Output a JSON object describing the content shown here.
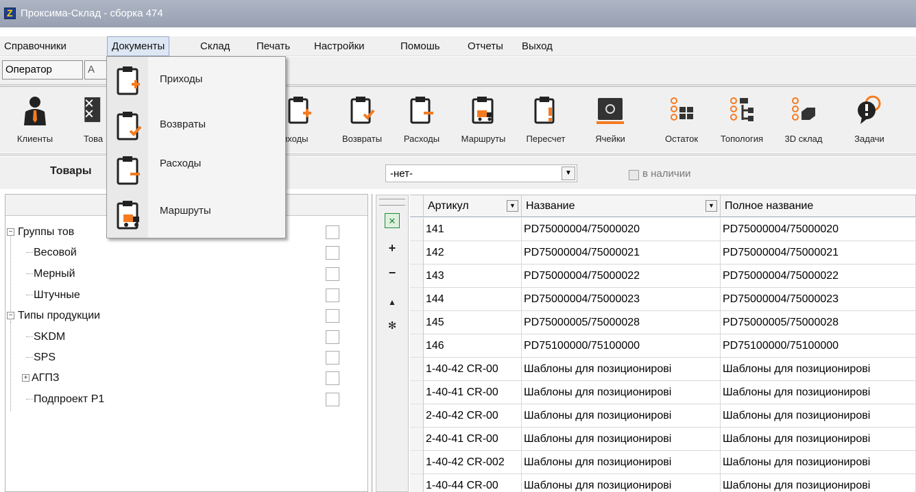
{
  "window": {
    "title": "Проксима-Склад - сборка 474"
  },
  "menu": [
    "Справочники",
    "Документы",
    "Склад",
    "Печать",
    "Настройки",
    "Помошь",
    "Отчеты",
    "Выход"
  ],
  "operator": {
    "label": "Оператор",
    "second": "А"
  },
  "toolbar": [
    {
      "label": "Клиенты",
      "icon": "person-icon"
    },
    {
      "label": "Товары",
      "icon": "barcode-icon"
    },
    {
      "label": "Приходы",
      "icon": "clipboard-plus-icon"
    },
    {
      "label": "Возвраты",
      "icon": "clipboard-check-icon"
    },
    {
      "label": "Расходы",
      "icon": "clipboard-minus-icon"
    },
    {
      "label": "Маршруты",
      "icon": "clipboard-truck-icon"
    },
    {
      "label": "Пересчет",
      "icon": "clipboard-exclamation-icon"
    },
    {
      "label": "Ячейки",
      "icon": "cell-safe-icon"
    },
    {
      "label": "Остаток",
      "icon": "remainder-grid-icon"
    },
    {
      "label": "Топология",
      "icon": "topology-icon"
    },
    {
      "label": "3D склад",
      "icon": "3d-warehouse-icon"
    },
    {
      "label": "Задачи",
      "icon": "tasks-bubble-icon"
    }
  ],
  "toolbar_visible": {
    "products_label": "Това",
    "prihody_label": "иходы"
  },
  "filter": {
    "label": "Товары",
    "label_visible": "Товары",
    "combo_value": "-нет-",
    "in_stock_label": "в наличии"
  },
  "tree": [
    {
      "text": "Группы тов",
      "level": 0,
      "expander": "−"
    },
    {
      "text": "Весовой",
      "level": 1
    },
    {
      "text": "Мерный",
      "level": 1
    },
    {
      "text": "Штучные",
      "level": 1
    },
    {
      "text": "Типы продукции",
      "level": 0,
      "expander": "−"
    },
    {
      "text": "SKDM",
      "level": 1
    },
    {
      "text": "SPS",
      "level": 1
    },
    {
      "text": "АГПЗ",
      "level": 1,
      "expander": "+"
    },
    {
      "text": "Подпроект P1",
      "level": 1
    }
  ],
  "grid": {
    "columns": [
      "Артикул",
      "Название",
      "Полное название"
    ],
    "rows": [
      [
        "141",
        "PD75000004/75000020",
        "PD75000004/75000020"
      ],
      [
        "142",
        "PD75000004/75000021",
        "PD75000004/75000021"
      ],
      [
        "143",
        "PD75000004/75000022",
        "PD75000004/75000022"
      ],
      [
        "144",
        "PD75000004/75000023",
        "PD75000004/75000023"
      ],
      [
        "145",
        "PD75000005/75000028",
        "PD75000005/75000028"
      ],
      [
        "146",
        "PD75100000/75100000",
        "PD75100000/75100000"
      ],
      [
        "1-40-42 CR-00",
        "Шаблоны для позиционировi",
        "Шаблоны для позиционировi"
      ],
      [
        "1-40-41 CR-00",
        "Шаблоны для позиционировi",
        "Шаблоны для позиционировi"
      ],
      [
        "2-40-42 CR-00",
        "Шаблоны для позиционировi",
        "Шаблоны для позиционировi"
      ],
      [
        "2-40-41 CR-00",
        "Шаблоны для позиционировi",
        "Шаблоны для позиционировi"
      ],
      [
        "1-40-42 CR-002",
        "Шаблоны для позиционировi",
        "Шаблоны для позиционировi"
      ],
      [
        "1-40-44 CR-00",
        "Шаблоны для позиционировi",
        "Шаблоны для позиционировi"
      ]
    ]
  },
  "documents_menu": [
    {
      "label": "Приходы",
      "icon": "clipboard-plus-icon"
    },
    {
      "label": "Возвраты",
      "icon": "clipboard-check-icon"
    },
    {
      "label": "Расходы",
      "icon": "clipboard-minus-icon"
    },
    {
      "label": "Маршруты",
      "icon": "clipboard-truck-icon"
    }
  ],
  "colors": {
    "accent_orange": "#f47b20",
    "dark_icon": "#2b2b2b",
    "excel_green": "#1e8a3a"
  }
}
